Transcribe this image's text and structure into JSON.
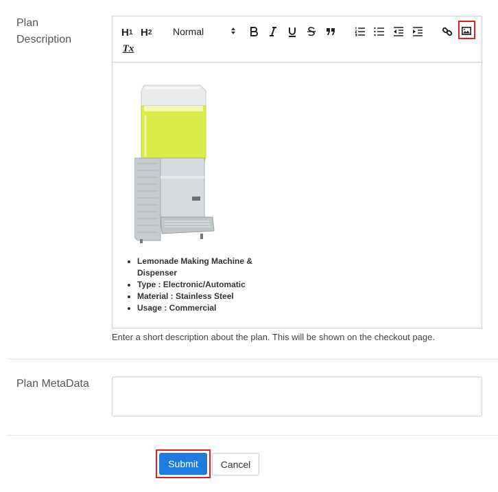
{
  "plan_description": {
    "label_line1": "Plan",
    "label_line2": "Description",
    "toolbar": {
      "h1": "H",
      "h1_sub": "1",
      "h2": "H",
      "h2_sub": "2",
      "format_select": "Normal",
      "clear_format": "Tx",
      "icons": [
        "bold-icon",
        "italic-icon",
        "underline-icon",
        "strike-icon",
        "blockquote-icon",
        "ordered-list-icon",
        "bullet-list-icon",
        "outdent-icon",
        "indent-icon",
        "link-icon",
        "image-icon",
        "clear-format-icon"
      ]
    },
    "content": {
      "image": "lemonade-dispenser-image",
      "bullets": [
        "Lemonade Making Machine & Dispenser",
        "Type : Electronic/Automatic",
        "Material : Stainless Steel",
        "Usage : Commercial"
      ]
    },
    "hint": "Enter a short description about the plan. This will be shown on the checkout page."
  },
  "plan_metadata": {
    "label": "Plan MetaData",
    "value": ""
  },
  "actions": {
    "submit": "Submit",
    "cancel": "Cancel"
  },
  "colors": {
    "primary": "#1e7be0",
    "highlight": "#e02020",
    "border": "#d0d0d0"
  }
}
